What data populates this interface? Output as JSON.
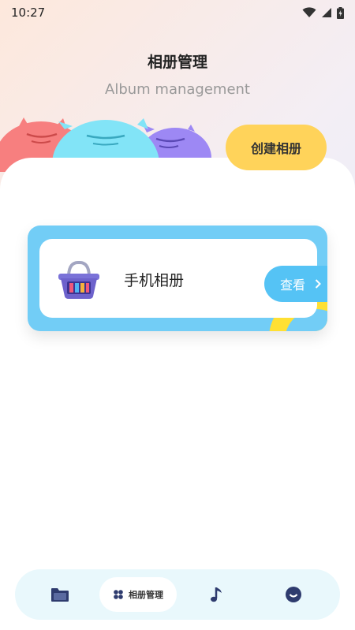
{
  "status_bar": {
    "time": "10:27"
  },
  "header": {
    "title": "相册管理",
    "subtitle": "Album management",
    "create_button_label": "创建相册"
  },
  "album_card": {
    "name": "手机相册",
    "view_label": "查看",
    "icon": "basket-icon"
  },
  "bottom_nav": {
    "items": [
      {
        "icon": "folder-icon",
        "label": ""
      },
      {
        "icon": "four-petal-icon",
        "label": "相册管理",
        "active": true
      },
      {
        "icon": "music-note-icon",
        "label": ""
      },
      {
        "icon": "smile-face-icon",
        "label": ""
      }
    ]
  },
  "colors": {
    "accent_blue": "#72cdf6",
    "create_button": "#ffd35a",
    "nav_bg": "#e9f8fc"
  }
}
